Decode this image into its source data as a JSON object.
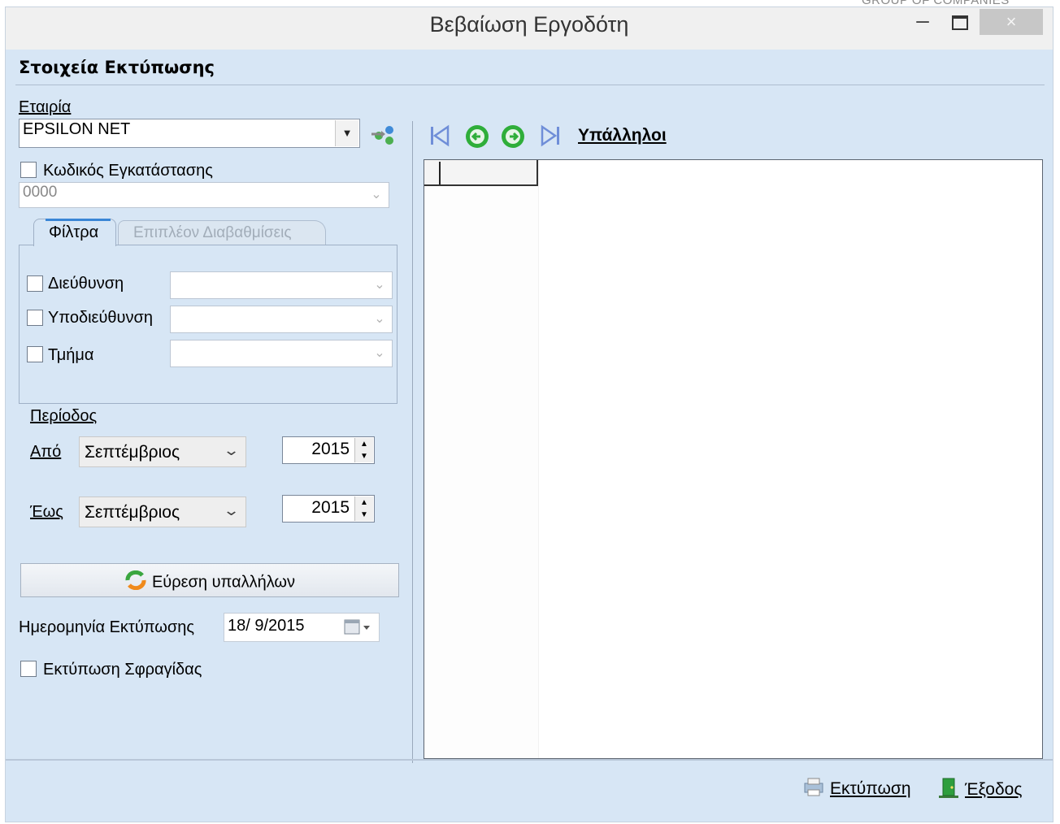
{
  "watermark": "GROUP OF COMPANIES",
  "window": {
    "title": "Βεβαίωση Εργοδότη",
    "minimize_glyph": "–",
    "close_glyph": "×"
  },
  "print_details": {
    "section_title": "Στοιχεία Εκτύπωσης",
    "company_label": "Εταιρία",
    "company_value": "EPSILON NET",
    "install_code_label": "Κωδικός Εγκατάστασης",
    "install_code_value": "0000",
    "install_code_checked": false
  },
  "tabs": {
    "filters": "Φίλτρα",
    "more_settings": "Επιπλέον Διαβαθμίσεις",
    "active": "filters"
  },
  "filters": {
    "address_label": "Διεύθυνση",
    "subaddress_label": "Υποδιεύθυνση",
    "department_label": "Τμήμα"
  },
  "period": {
    "label": "Περίοδος",
    "from_label": "Από",
    "to_label": "Έως",
    "from_month": "Σεπτέμβριος",
    "from_year": "2015",
    "to_month": "Σεπτέμβριος",
    "to_year": "2015"
  },
  "find_employees_label": "Εύρεση υπαλλήλων",
  "print_date": {
    "label": "Ημερομηνία Εκτύπωσης",
    "value": "18/ 9/2015"
  },
  "print_stamp_label": "Εκτύπωση Σφραγίδας",
  "employees": {
    "title": "Υπάλληλοι",
    "first_icon": "first-record-icon",
    "prev_icon": "previous-record-icon",
    "next_icon": "next-record-icon",
    "last_icon": "last-record-icon"
  },
  "footer": {
    "print_label": "Εκτύπωση",
    "exit_label": "Έξοδος"
  },
  "colors": {
    "window_bg": "#d7e6f5",
    "tab_accent": "#3a86d6",
    "nav_green": "#2fae3a",
    "nav_blue": "#4a7fd6"
  }
}
